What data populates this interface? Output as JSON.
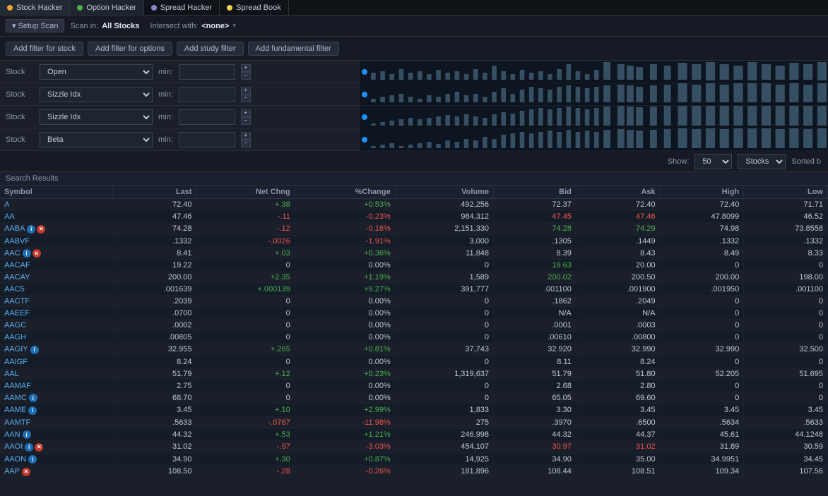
{
  "nav": {
    "tabs": [
      {
        "label": "Stock Hacker",
        "dot_color": "#f0a030",
        "active": false
      },
      {
        "label": "Option Hacker",
        "dot_color": "#4caf50",
        "active": true
      },
      {
        "label": "Spread Hacker",
        "dot_color": "#8888cc",
        "active": false
      },
      {
        "label": "Spread Book",
        "dot_color": "#f0d050",
        "active": false
      }
    ]
  },
  "toolbar": {
    "setup_scan": "▾ Setup Scan",
    "scan_in_label": "Scan in:",
    "scan_in_value": "All Stocks",
    "intersect_label": "Intersect with:",
    "intersect_value": "<none>"
  },
  "filter_buttons": {
    "add_stock": "Add filter for stock",
    "add_options": "Add filter for options",
    "add_study": "Add study filter",
    "add_fundamental": "Add fundamental filter"
  },
  "filter_rows": [
    {
      "label": "Stock",
      "field": "Open",
      "min_label": "min:",
      "min_val": ""
    },
    {
      "label": "Stock",
      "field": "Sizzle Idx",
      "min_label": "min:",
      "min_val": ""
    },
    {
      "label": "Stock",
      "field": "Sizzle Idx",
      "min_label": "min:",
      "min_val": ""
    },
    {
      "label": "Stock",
      "field": "Beta",
      "min_label": "min:",
      "min_val": ""
    }
  ],
  "show_bar": {
    "show_label": "Show:",
    "show_value": "50",
    "type_value": "Stocks",
    "sorted_label": "Sorted b"
  },
  "results": {
    "header": "Search Results",
    "columns": [
      "Symbol",
      "Last",
      "Net Chng",
      "%Change",
      "Volume",
      "Bid",
      "Ask",
      "High",
      "Low"
    ],
    "rows": [
      {
        "symbol": "A",
        "icons": [],
        "last": "72.40",
        "net": "+.38",
        "pct": "+0.53%",
        "vol": "492,256",
        "bid": "72.37",
        "ask": "72.40",
        "high": "72.40",
        "low": "71.71",
        "net_class": "positive",
        "pct_class": "positive"
      },
      {
        "symbol": "AA",
        "icons": [],
        "last": "47.46",
        "net": "-.11",
        "pct": "-0.23%",
        "vol": "984,312",
        "bid": "47.45",
        "ask": "47.46",
        "high": "47.8099",
        "low": "46.52",
        "net_class": "negative",
        "pct_class": "negative"
      },
      {
        "symbol": "AABA",
        "icons": [
          "i",
          "x"
        ],
        "last": "74.28",
        "net": "-.12",
        "pct": "-0.16%",
        "vol": "2,151,330",
        "bid": "74.28",
        "ask": "74.29",
        "high": "74.98",
        "low": "73.8558",
        "net_class": "negative",
        "pct_class": "negative"
      },
      {
        "symbol": "AABVF",
        "icons": [],
        "last": ".1332",
        "net": "-.0026",
        "pct": "-1.91%",
        "vol": "3,000",
        "bid": ".1305",
        "ask": ".1449",
        "high": ".1332",
        "low": ".1332",
        "net_class": "negative",
        "pct_class": "negative"
      },
      {
        "symbol": "AAC",
        "icons": [
          "i",
          "x"
        ],
        "last": "8.41",
        "net": "+.03",
        "pct": "+0.36%",
        "vol": "11,848",
        "bid": "8.39",
        "ask": "8.43",
        "high": "8.49",
        "low": "8.33",
        "net_class": "positive",
        "pct_class": "positive"
      },
      {
        "symbol": "AACAF",
        "icons": [],
        "last": "19.22",
        "net": "0",
        "pct": "0.00%",
        "vol": "0",
        "bid": "19.63",
        "ask": "20.00",
        "high": "0",
        "low": "0",
        "net_class": "neutral",
        "pct_class": "neutral"
      },
      {
        "symbol": "AACAY",
        "icons": [],
        "last": "200.00",
        "net": "+2.35",
        "pct": "+1.19%",
        "vol": "1,589",
        "bid": "200.02",
        "ask": "200.50",
        "high": "200.00",
        "low": "198.00",
        "net_class": "positive",
        "pct_class": "positive"
      },
      {
        "symbol": "AAC5",
        "icons": [],
        "last": ".001639",
        "net": "+.000139",
        "pct": "+9.27%",
        "vol": "391,777",
        "bid": ".001100",
        "ask": ".001900",
        "high": ".001950",
        "low": ".001100",
        "net_class": "positive",
        "pct_class": "positive"
      },
      {
        "symbol": "AACTF",
        "icons": [],
        "last": ".2039",
        "net": "0",
        "pct": "0.00%",
        "vol": "0",
        "bid": ".1862",
        "ask": ".2049",
        "high": "0",
        "low": "0",
        "net_class": "neutral",
        "pct_class": "neutral"
      },
      {
        "symbol": "AAEEF",
        "icons": [],
        "last": ".0700",
        "net": "0",
        "pct": "0.00%",
        "vol": "0",
        "bid": "N/A",
        "ask": "N/A",
        "high": "0",
        "low": "0",
        "net_class": "neutral",
        "pct_class": "neutral"
      },
      {
        "symbol": "AAGC",
        "icons": [],
        "last": ".0002",
        "net": "0",
        "pct": "0.00%",
        "vol": "0",
        "bid": ".0001",
        "ask": ".0003",
        "high": "0",
        "low": "0",
        "net_class": "neutral",
        "pct_class": "neutral"
      },
      {
        "symbol": "AAGH",
        "icons": [],
        "last": ".00805",
        "net": "0",
        "pct": "0.00%",
        "vol": "0",
        "bid": ".00610",
        "ask": ".00800",
        "high": "0",
        "low": "0",
        "net_class": "neutral",
        "pct_class": "neutral"
      },
      {
        "symbol": "AAGIY",
        "icons": [
          "i"
        ],
        "last": "32.955",
        "net": "+.265",
        "pct": "+0.81%",
        "vol": "37,743",
        "bid": "32.920",
        "ask": "32.990",
        "high": "32.990",
        "low": "32.500",
        "net_class": "positive",
        "pct_class": "positive"
      },
      {
        "symbol": "AAIGF",
        "icons": [],
        "last": "8.24",
        "net": "0",
        "pct": "0.00%",
        "vol": "0",
        "bid": "8.11",
        "ask": "8.24",
        "high": "0",
        "low": "0",
        "net_class": "neutral",
        "pct_class": "neutral"
      },
      {
        "symbol": "AAL",
        "icons": [],
        "last": "51.79",
        "net": "+.12",
        "pct": "+0.23%",
        "vol": "1,319,637",
        "bid": "51.79",
        "ask": "51.80",
        "high": "52.205",
        "low": "51.695",
        "net_class": "positive",
        "pct_class": "positive"
      },
      {
        "symbol": "AAMAF",
        "icons": [],
        "last": "2.75",
        "net": "0",
        "pct": "0.00%",
        "vol": "0",
        "bid": "2.68",
        "ask": "2.80",
        "high": "0",
        "low": "0",
        "net_class": "neutral",
        "pct_class": "neutral"
      },
      {
        "symbol": "AAMC",
        "icons": [
          "i"
        ],
        "last": "68.70",
        "net": "0",
        "pct": "0.00%",
        "vol": "0",
        "bid": "65.05",
        "ask": "69.60",
        "high": "0",
        "low": "0",
        "net_class": "neutral",
        "pct_class": "neutral"
      },
      {
        "symbol": "AAME",
        "icons": [
          "i"
        ],
        "last": "3.45",
        "net": "+.10",
        "pct": "+2.99%",
        "vol": "1,833",
        "bid": "3.30",
        "ask": "3.45",
        "high": "3.45",
        "low": "3.45",
        "net_class": "positive",
        "pct_class": "positive"
      },
      {
        "symbol": "AAMTF",
        "icons": [],
        "last": ".5633",
        "net": "-.0767",
        "pct": "-11.98%",
        "vol": "275",
        "bid": ".3970",
        "ask": ".6500",
        "high": ".5634",
        "low": ".5633",
        "net_class": "negative",
        "pct_class": "negative"
      },
      {
        "symbol": "AAN",
        "icons": [
          "i"
        ],
        "last": "44.32",
        "net": "+.53",
        "pct": "+1.21%",
        "vol": "246,998",
        "bid": "44.32",
        "ask": "44.37",
        "high": "45.61",
        "low": "44.1248",
        "net_class": "positive",
        "pct_class": "positive"
      },
      {
        "symbol": "AAOI",
        "icons": [
          "i",
          "x"
        ],
        "last": "31.02",
        "net": "-.97",
        "pct": "-3.03%",
        "vol": "454,107",
        "bid": "30.97",
        "ask": "31.02",
        "high": "31.89",
        "low": "30.59",
        "net_class": "negative",
        "pct_class": "negative"
      },
      {
        "symbol": "AAON",
        "icons": [
          "i"
        ],
        "last": "34.90",
        "net": "+.30",
        "pct": "+0.87%",
        "vol": "14,925",
        "bid": "34.90",
        "ask": "35.00",
        "high": "34.9951",
        "low": "34.45",
        "net_class": "positive",
        "pct_class": "positive"
      },
      {
        "symbol": "AAP",
        "icons": [
          "x"
        ],
        "last": "108.50",
        "net": "-.28",
        "pct": "-0.26%",
        "vol": "181,896",
        "bid": "108.44",
        "ask": "108.51",
        "high": "109.34",
        "low": "107.56",
        "net_class": "negative",
        "pct_class": "negative"
      }
    ]
  }
}
